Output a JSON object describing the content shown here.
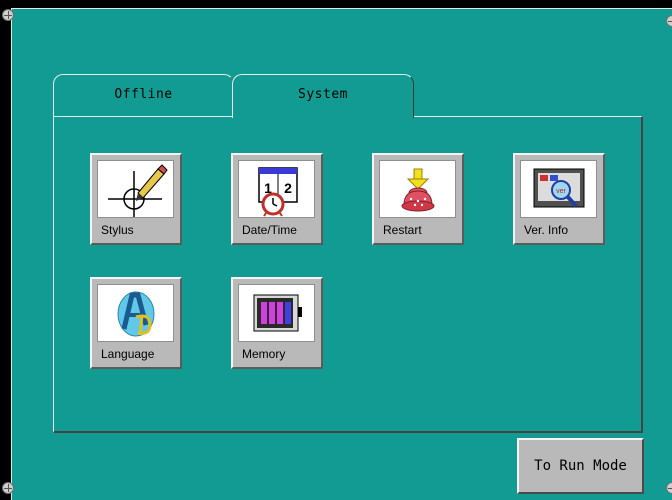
{
  "tabs": [
    {
      "label": "Offline",
      "active": false
    },
    {
      "label": "System",
      "active": true
    }
  ],
  "tiles": [
    {
      "label": "Stylus",
      "icon": "stylus-icon"
    },
    {
      "label": "Date/Time",
      "icon": "calendar-clock-icon"
    },
    {
      "label": "Restart",
      "icon": "restart-icon"
    },
    {
      "label": "Ver. Info",
      "icon": "version-info-icon"
    },
    {
      "label": "Language",
      "icon": "language-icon"
    },
    {
      "label": "Memory",
      "icon": "memory-icon"
    }
  ],
  "calendar": {
    "left": "1",
    "right": "2"
  },
  "run_button": {
    "label": "To Run Mode"
  },
  "colors": {
    "panel": "#119b92",
    "tile": "#b9b9b9",
    "frame": "#000000"
  }
}
